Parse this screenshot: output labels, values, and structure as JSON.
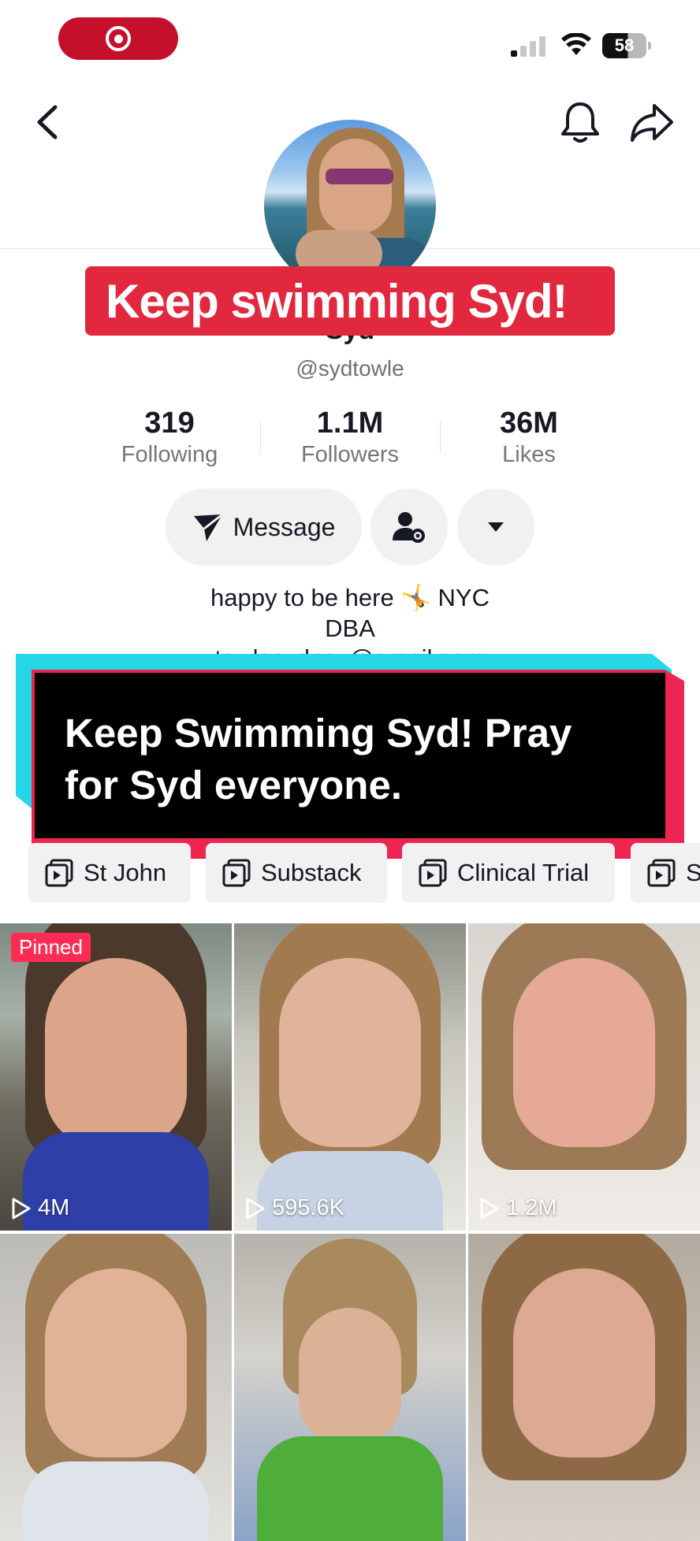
{
  "status_bar": {
    "battery": "58"
  },
  "profile": {
    "name": "Syd",
    "username": "@sydtowle",
    "stats": [
      {
        "value": "319",
        "label": "Following"
      },
      {
        "value": "1.1M",
        "label": "Followers"
      },
      {
        "value": "36M",
        "label": "Likes"
      }
    ],
    "message_label": "Message",
    "bio_line1": "happy to be here 🤸 NYC",
    "bio_line2": "DBA",
    "bio_line3": "towlesydney@gmail.com"
  },
  "overlays": {
    "top_banner": "Keep swimming Syd!",
    "caption_line1": "Keep Swimming Syd!  Pray",
    "caption_line2": "for Syd everyone."
  },
  "playlists": [
    {
      "label": "St John"
    },
    {
      "label": "Substack"
    },
    {
      "label": "Clinical Trial"
    },
    {
      "label": "S"
    }
  ],
  "videos": [
    {
      "views": "4M",
      "badge": "Pinned"
    },
    {
      "views": "595.6K"
    },
    {
      "views": "1.2M"
    },
    {
      "views": ""
    },
    {
      "views": ""
    },
    {
      "views": ""
    }
  ],
  "colors": {
    "accent_red": "#e2283f",
    "pinned_red": "#fe2c55",
    "caption_cyan": "#25d6e6",
    "caption_pink": "#ee2550",
    "recording_red": "#c4102b"
  },
  "icons": [
    "back-icon",
    "bell-icon",
    "share-icon",
    "send-icon",
    "user-gear-icon",
    "chevron-down-icon",
    "playlist-icon",
    "play-icon",
    "record-icon",
    "wifi-icon",
    "signal-icon",
    "battery-icon"
  ]
}
